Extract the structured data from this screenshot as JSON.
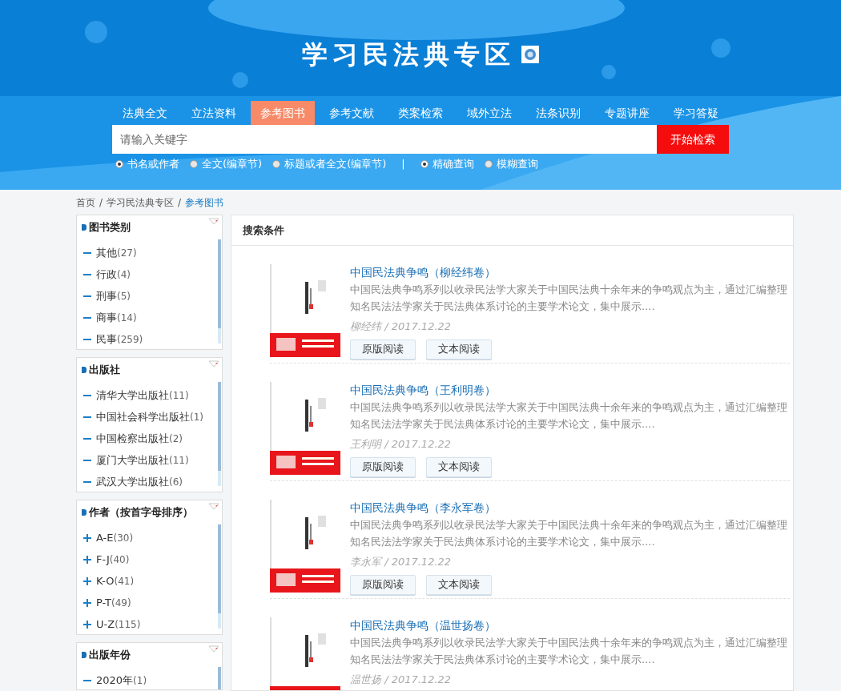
{
  "header": {
    "title": "学习民法典专区"
  },
  "nav": [
    {
      "label": "法典全文",
      "selected": false
    },
    {
      "label": "立法资料",
      "selected": false
    },
    {
      "label": "参考图书",
      "selected": true
    },
    {
      "label": "参考文献",
      "selected": false
    },
    {
      "label": "类案检索",
      "selected": false
    },
    {
      "label": "域外立法",
      "selected": false
    },
    {
      "label": "法条识别",
      "selected": false
    },
    {
      "label": "专题讲座",
      "selected": false
    },
    {
      "label": "学习答疑",
      "selected": false
    }
  ],
  "search": {
    "placeholder": "请输入关键字",
    "button": "开始检索"
  },
  "scope_options": [
    {
      "label": "书名或作者",
      "selected": true
    },
    {
      "label": "全文(编章节)",
      "selected": false
    },
    {
      "label": "标题或者全文(编章节)",
      "selected": false
    }
  ],
  "separator": "|",
  "match_options": [
    {
      "label": "精确查询",
      "selected": true
    },
    {
      "label": "模糊查询",
      "selected": false
    }
  ],
  "breadcrumb": [
    {
      "label": "首页",
      "selected": false
    },
    {
      "label": "学习民法典专区",
      "selected": false
    },
    {
      "label": "参考图书",
      "selected": true
    }
  ],
  "breadcrumb_separator": "/",
  "filters": [
    {
      "title": "图书类别",
      "items": [
        {
          "name": "其他",
          "count": "(27)",
          "expanded": true
        },
        {
          "name": "行政",
          "count": "(4)",
          "expanded": true
        },
        {
          "name": "刑事",
          "count": "(5)",
          "expanded": true
        },
        {
          "name": "商事",
          "count": "(14)",
          "expanded": true
        },
        {
          "name": "民事",
          "count": "(259)",
          "expanded": true
        }
      ]
    },
    {
      "title": "出版社",
      "items": [
        {
          "name": "清华大学出版社",
          "count": "(11)",
          "expanded": true
        },
        {
          "name": "中国社会科学出版社",
          "count": "(1)",
          "expanded": true
        },
        {
          "name": "中国检察出版社",
          "count": "(2)",
          "expanded": true
        },
        {
          "name": "厦门大学出版社",
          "count": "(11)",
          "expanded": true
        },
        {
          "name": "武汉大学出版社",
          "count": "(6)",
          "expanded": true
        }
      ]
    },
    {
      "title": "作者（按首字母排序）",
      "items": [
        {
          "name": "A-E",
          "count": "(30)",
          "expanded": false
        },
        {
          "name": "F-J",
          "count": "(40)",
          "expanded": false
        },
        {
          "name": "K-O",
          "count": "(41)",
          "expanded": false
        },
        {
          "name": "P-T",
          "count": "(49)",
          "expanded": false
        },
        {
          "name": "U-Z",
          "count": "(115)",
          "expanded": false
        }
      ]
    },
    {
      "title": "出版年份",
      "items": [
        {
          "name": "2020年",
          "count": "(1)",
          "expanded": true
        }
      ]
    }
  ],
  "results": {
    "title": "搜索条件",
    "books": [
      {
        "title": "中国民法典争鸣（柳经纬卷）",
        "summary": "中国民法典争鸣系列以收录民法学大家关于中国民法典十余年来的争鸣观点为主，通过汇编整理知名民法法学家关于民法典体系讨论的主要学术论文，集中展示....",
        "meta": "柳经纬 / 2017.12.22",
        "buttons": [
          "原版阅读",
          "文本阅读"
        ]
      },
      {
        "title": "中国民法典争鸣（王利明卷）",
        "summary": "中国民法典争鸣系列以收录民法学大家关于中国民法典十余年来的争鸣观点为主，通过汇编整理知名民法法学家关于民法典体系讨论的主要学术论文，集中展示....",
        "meta": "王利明 / 2017.12.22",
        "buttons": [
          "原版阅读",
          "文本阅读"
        ]
      },
      {
        "title": "中国民法典争鸣（李永军卷）",
        "summary": "中国民法典争鸣系列以收录民法学大家关于中国民法典十余年来的争鸣观点为主，通过汇编整理知名民法法学家关于民法典体系讨论的主要学术论文，集中展示....",
        "meta": "李永军 / 2017.12.22",
        "buttons": [
          "原版阅读",
          "文本阅读"
        ]
      },
      {
        "title": "中国民法典争鸣（温世扬卷）",
        "summary": "中国民法典争鸣系列以收录民法学大家关于中国民法典十余年来的争鸣观点为主，通过汇编整理知名民法法学家关于民法典体系讨论的主要学术论文，集中展示....",
        "meta": "温世扬 / 2017.12.22"
      }
    ]
  }
}
